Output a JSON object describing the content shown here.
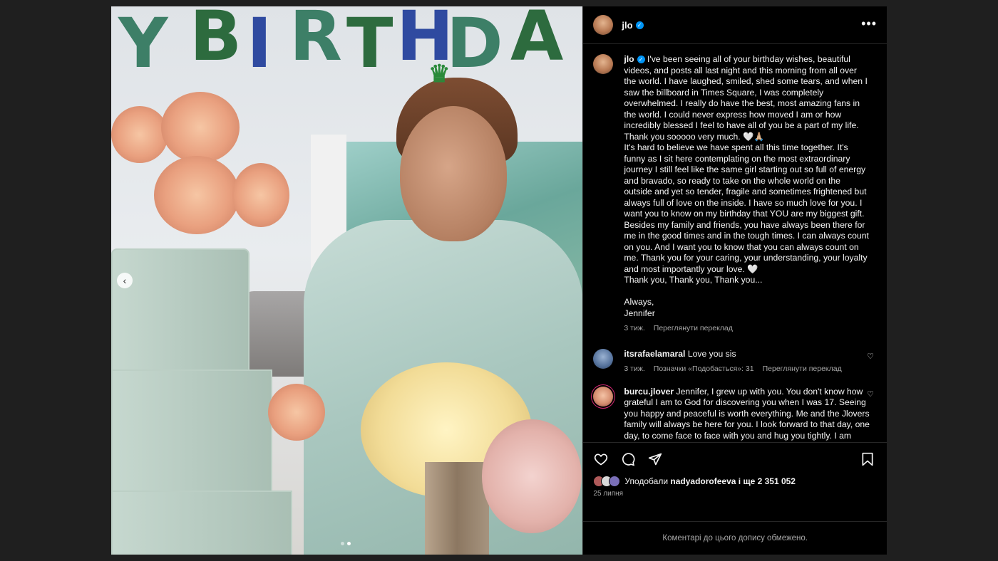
{
  "post": {
    "username": "jlo",
    "verified_mark": "✓",
    "more_label": "•••"
  },
  "media": {
    "balloons": [
      "Y",
      "B",
      "I",
      "R",
      "T",
      "H",
      "D",
      "A"
    ],
    "balloon_colors": [
      "#3d7f67",
      "#2d6b3e",
      "#2f4aa0",
      "#3d7f67",
      "#2d6b3e",
      "#2f4aa0",
      "#3d7f67",
      "#2d6b3e"
    ],
    "prev_label": "‹",
    "slide_count": 2,
    "active_slide": 1
  },
  "caption": {
    "username": "jlo",
    "text": "I've been seeing all of your birthday wishes, beautiful videos, and posts all last night and this morning from all over the world. I have laughed, smiled, shed some tears, and when I saw the billboard in Times Square, I was completely overwhelmed. I really do have the best, most amazing fans in the world. I could never express how moved I am or how incredibly blessed I feel to have all of you be a part of my life. Thank you sooooo very much. 🤍🙏🏼\nIt's hard to believe we have spent all this time together. It's funny as I sit here contemplating on the most extraordinary journey I still feel like the same girl starting out so full of energy and bravado, so ready to take on the whole world on the outside and yet so tender, fragile and sometimes frightened but always full of love on the inside. I have so much love for you. I want you to know on my birthday that YOU are my biggest gift. Besides my family and friends, you have always been there for me in the good times and in the tough times. I can always count on you. And I want you to know that you can always count on me. Thank you for your caring, your understanding, your loyalty and most importantly your love. 🤍\nThank you, Thank you, Thank you...\n\nAlways,\nJennifer",
    "time": "3 тиж.",
    "translate": "Переглянути переклад"
  },
  "comments": [
    {
      "username": "itsrafaelamaral",
      "text": "Love you sis",
      "time": "3 тиж.",
      "likes": "Позначки «Подобається»: 31",
      "translate": "Переглянути переклад"
    },
    {
      "username": "burcu.jlover",
      "text": "Jennifer, I grew up with you. You don't know how grateful I am to God for discovering you when I was 17. Seeing you happy and peaceful is worth everything. Me and the Jlovers family will always be here for you. I look forward to that day, one day, to come face to face with you and hug you tightly. I am here until my last breath, with God's permission"
    }
  ],
  "likes": {
    "prefix": "Уподобали",
    "user": "nadyadorofeeva",
    "suffix": "і ще 2 351 052"
  },
  "date": "25 липня",
  "comments_limited": "Коментарі до цього допису обмежено.",
  "icons": [
    "heart-icon",
    "comment-icon",
    "share-icon",
    "bookmark-icon",
    "chevron-left-icon",
    "more-icon",
    "verified-icon"
  ],
  "colors": {
    "background": "#000000",
    "accent": "#0095f6",
    "muted": "#a8a8a8",
    "overlay": "#1f1f1f"
  }
}
